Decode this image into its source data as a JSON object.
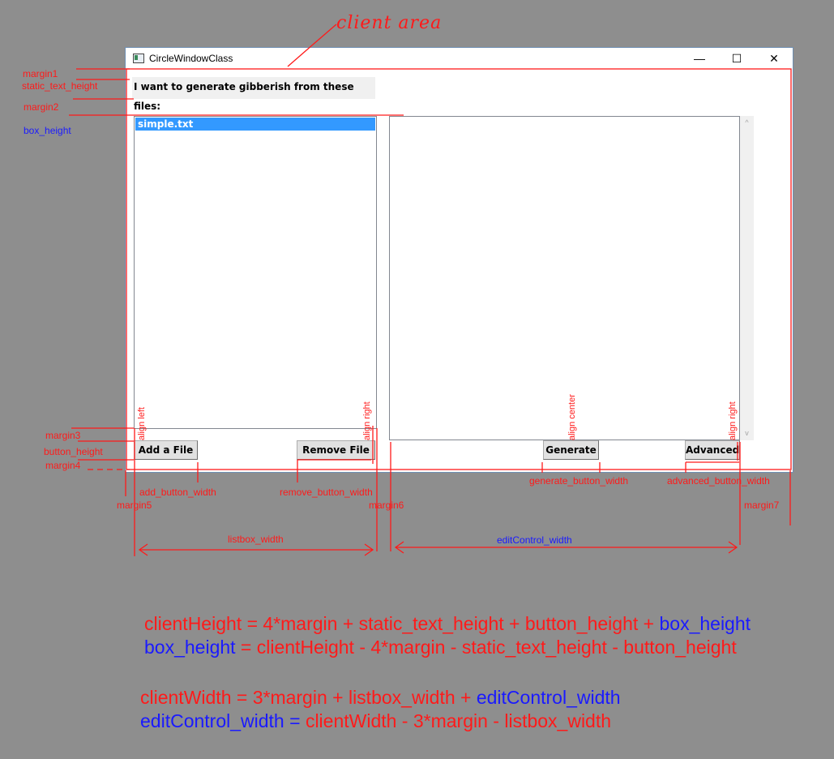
{
  "annotation": {
    "client_area": "client area"
  },
  "window": {
    "title": "CircleWindowClass",
    "minimize_glyph": "—",
    "maximize_glyph": "☐",
    "close_glyph": "✕",
    "static_text": "I want to generate gibberish from these files:",
    "listbox_items": [
      "simple.txt"
    ],
    "buttons": {
      "add": "Add a File",
      "remove": "Remove File",
      "generate": "Generate",
      "advanced": "Advanced"
    },
    "scroll_up_glyph": "^",
    "scroll_down_glyph": "v"
  },
  "labels": {
    "margin1": "margin1",
    "static_text_height": "static_text_height",
    "margin2": "margin2",
    "box_height": "box_height",
    "margin3": "margin3",
    "button_height": "button_height",
    "margin4": "margin4",
    "add_button_width": "add_button_width",
    "margin5": "margin5",
    "remove_button_width": "remove_button_width",
    "margin6": "margin6",
    "generate_button_width": "generate_button_width",
    "advanced_button_width": "advanced_button_width",
    "margin7": "margin7",
    "listbox_width": "listbox_width",
    "editControl_width": "editControl_width",
    "align_left": "align left",
    "align_right_1": "align right",
    "align_center": "align center",
    "align_right_2": "align right"
  },
  "formulas": {
    "line1": [
      {
        "text": "clientHeight = 4*margin + static_text_height + button_height + ",
        "color": "#ff1a1a"
      },
      {
        "text": "box_height",
        "color": "#1a1aff"
      }
    ],
    "line2": [
      {
        "text": "box_height",
        "color": "#1a1aff"
      },
      {
        "text": " = clientHeight - 4*margin - static_text_height - button_height",
        "color": "#ff1a1a"
      }
    ],
    "line3": [
      {
        "text": "clientWidth = 3*margin + listbox_width + ",
        "color": "#ff1a1a"
      },
      {
        "text": "editControl_width",
        "color": "#1a1aff"
      }
    ],
    "line4": [
      {
        "text": "editControl_width",
        "color": "#1a1aff"
      },
      {
        "text": " = ",
        "color": "#1a1aff"
      },
      {
        "text": "clientWidth - 3*margin - listbox_width",
        "color": "#ff1a1a"
      }
    ]
  },
  "colors": {
    "annotation_red": "#ff1a1a",
    "annotation_blue": "#1a1aff",
    "selection": "#3399ff",
    "background": "#8e8e8e"
  }
}
